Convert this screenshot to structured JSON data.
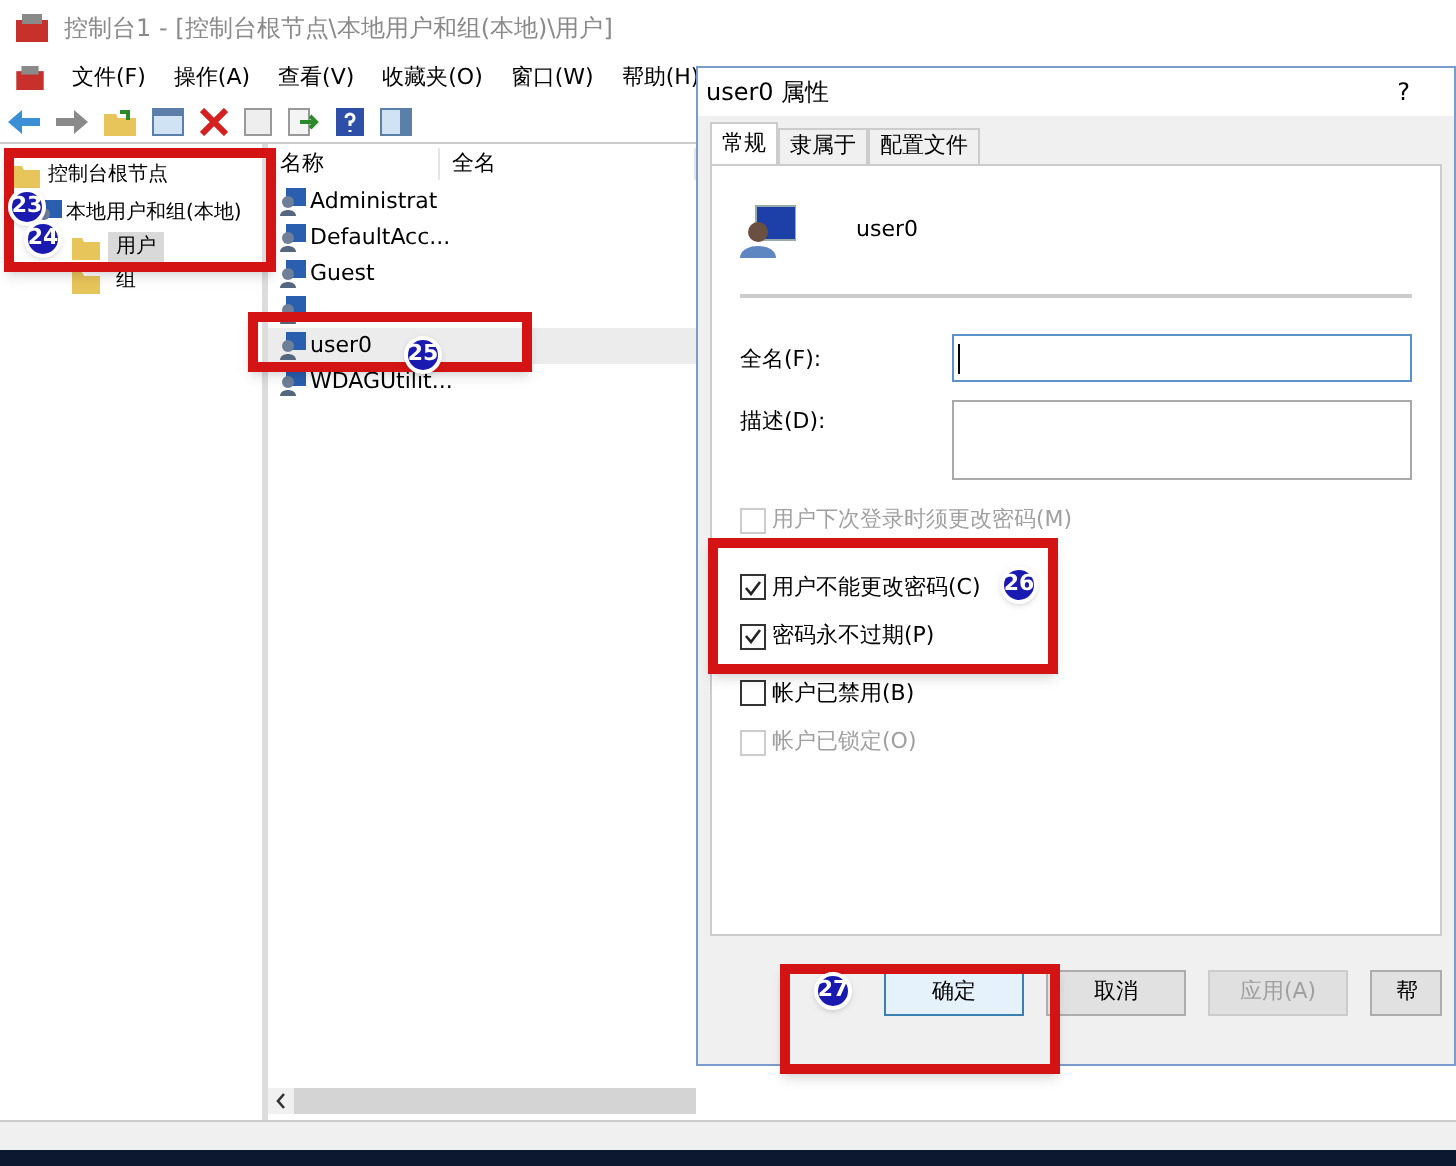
{
  "window": {
    "title": "控制台1 - [控制台根节点\\本地用户和组(本地)\\用户]"
  },
  "menu": [
    "文件(F)",
    "操作(A)",
    "查看(V)",
    "收藏夹(O)",
    "窗口(W)",
    "帮助(H)"
  ],
  "tree": {
    "label": "控制台根节点",
    "children": [
      {
        "label": "本地用户和组(本地)",
        "badge": "23",
        "children": [
          {
            "label": "用户",
            "selected": true,
            "badge": "24"
          },
          {
            "label": "组",
            "selected": false
          }
        ]
      }
    ]
  },
  "list": {
    "columns": [
      "名称",
      "全名"
    ],
    "rows": [
      {
        "name": "Administrat",
        "selected": false
      },
      {
        "name": "DefaultAcc...",
        "selected": false
      },
      {
        "name": "Guest",
        "selected": false
      },
      {
        "selected": false
      },
      {
        "name": "user0",
        "selected": true,
        "badge": "25"
      },
      {
        "name": "WDAGUtilit...",
        "selected": false
      }
    ]
  },
  "dialog": {
    "title": "user0 属性",
    "help": "?",
    "tabs": [
      {
        "label": "常规",
        "selected": true
      },
      {
        "label": "隶属于",
        "selected": false
      },
      {
        "label": "配置文件",
        "selected": false
      }
    ],
    "user": "user0",
    "fields": [
      {
        "label": "全名(F):",
        "kind": "single",
        "focused": true
      },
      {
        "label": "描述(D):",
        "kind": "multi",
        "focused": false
      }
    ],
    "checkboxes": [
      {
        "label": "用户下次登录时须更改密码(M)",
        "checked": false,
        "disabled": true
      },
      {
        "label": "用户不能更改密码(C)",
        "checked": true,
        "disabled": false
      },
      {
        "label": "密码永不过期(P)",
        "checked": true,
        "disabled": false
      },
      {
        "label": "帐户已禁用(B)",
        "checked": false,
        "disabled": false
      },
      {
        "label": "帐户已锁定(O)",
        "checked": false,
        "disabled": true
      }
    ],
    "checkbox_badge": "26",
    "buttons": [
      {
        "label": "确定",
        "focused": true,
        "disabled": false,
        "badge": "27"
      },
      {
        "label": "取消",
        "focused": false,
        "disabled": false
      },
      {
        "label": "应用(A)",
        "focused": false,
        "disabled": true
      },
      {
        "label": "帮",
        "focused": false,
        "disabled": false
      }
    ]
  }
}
